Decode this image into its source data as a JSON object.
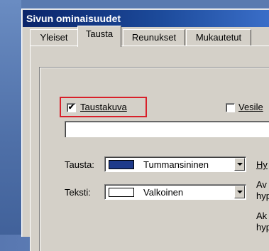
{
  "window": {
    "title": "Sivun ominaisuudet"
  },
  "tabs": [
    {
      "label": "Yleiset",
      "active": false
    },
    {
      "label": "Tausta",
      "active": true
    },
    {
      "label": "Reunukset",
      "active": false
    },
    {
      "label": "Mukautetut",
      "active": false
    }
  ],
  "background_image": {
    "label": "Taustakuva",
    "checked": true,
    "path_value": ""
  },
  "watermark": {
    "label": "Vesile",
    "checked": false
  },
  "colors": {
    "background": {
      "label": "Tausta:",
      "value": "Tummansininen",
      "swatch": "#1e3a8a"
    },
    "text": {
      "label": "Teksti:",
      "value": "Valkoinen",
      "swatch": "#ffffff"
    }
  },
  "hyperlinks": {
    "label_1": "Hy",
    "line_a": "Av",
    "line_b": "hyp",
    "line_c": "Ak",
    "line_d": "hyp"
  }
}
